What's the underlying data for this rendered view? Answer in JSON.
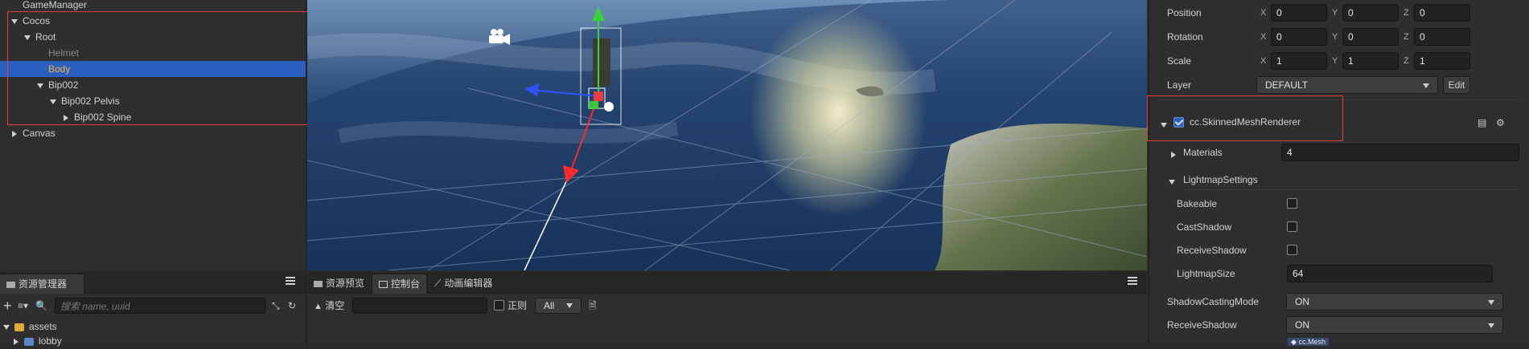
{
  "hierarchy": {
    "items": [
      {
        "label": "GameManager",
        "depth": 0,
        "expand": "none",
        "selected": false,
        "dim": false
      },
      {
        "label": "Cocos",
        "depth": 0,
        "expand": "down",
        "selected": false,
        "dim": false
      },
      {
        "label": "Root",
        "depth": 1,
        "expand": "down",
        "selected": false,
        "dim": false
      },
      {
        "label": "Helmet",
        "depth": 2,
        "expand": "none",
        "selected": false,
        "dim": true
      },
      {
        "label": "Body",
        "depth": 2,
        "expand": "none",
        "selected": true,
        "dim": false
      },
      {
        "label": "Bip002",
        "depth": 2,
        "expand": "down",
        "selected": false,
        "dim": false
      },
      {
        "label": "Bip002 Pelvis",
        "depth": 3,
        "expand": "down",
        "selected": false,
        "dim": false
      },
      {
        "label": "Bip002 Spine",
        "depth": 4,
        "expand": "right",
        "selected": false,
        "dim": false
      },
      {
        "label": "Canvas",
        "depth": 0,
        "expand": "right",
        "selected": false,
        "dim": false
      }
    ]
  },
  "assets": {
    "tab": "资源管理器",
    "search_placeholder": "搜索 name, uuid",
    "tree": [
      {
        "label": "assets"
      },
      {
        "label": "lobby"
      }
    ]
  },
  "console": {
    "tabs": [
      "资源预览",
      "控制台",
      "动画编辑器"
    ],
    "clear_label": "清空",
    "regex_label": "正则",
    "level_filter": "All"
  },
  "inspector": {
    "position": {
      "label": "Position",
      "x": "0",
      "y": "0",
      "z": "0"
    },
    "rotation": {
      "label": "Rotation",
      "x": "0",
      "y": "0",
      "z": "0"
    },
    "scale": {
      "label": "Scale",
      "x": "1",
      "y": "1",
      "z": "1"
    },
    "axis": {
      "x": "X",
      "y": "Y",
      "z": "Z"
    },
    "layer": {
      "label": "Layer",
      "value": "DEFAULT",
      "edit_label": "Edit"
    },
    "component": {
      "name": "cc.SkinnedMeshRenderer",
      "enabled": true
    },
    "materials": {
      "label": "Materials",
      "value": "4"
    },
    "lightmap": {
      "label": "LightmapSettings",
      "bakeable": "Bakeable",
      "cast_shadow": "CastShadow",
      "receive_shadow": "ReceiveShadow",
      "lightmap_size_label": "LightmapSize",
      "lightmap_size": "64"
    },
    "shadow_casting_mode": {
      "label": "ShadowCastingMode",
      "value": "ON"
    },
    "receive_shadow": {
      "label": "ReceiveShadow",
      "value": "ON"
    },
    "mesh_badge": "cc.Mesh"
  },
  "colors": {
    "selection": "#2a5fbf",
    "highlight_text": "#f0b33c",
    "annotation_red": "#e23b3b"
  }
}
